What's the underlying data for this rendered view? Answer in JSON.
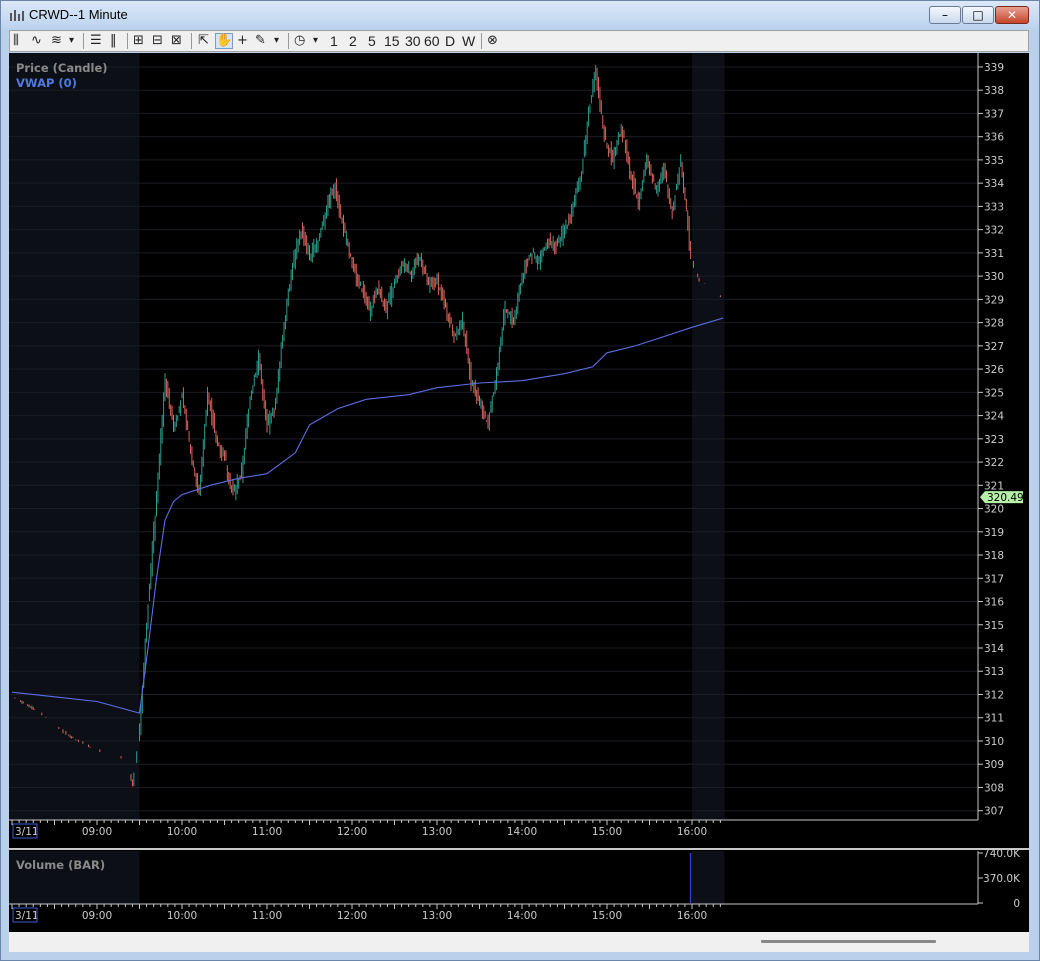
{
  "window": {
    "title": "CRWD--1 Minute",
    "controls": {
      "minimize": "–",
      "maximize": "□",
      "close": "✕"
    }
  },
  "toolbar": {
    "tools": [
      {
        "name": "bar-chart-icon",
        "glyph": "⫼"
      },
      {
        "name": "line-chart-icon",
        "glyph": "∿"
      },
      {
        "name": "indicator-icon",
        "glyph": "≋"
      },
      {
        "name": "chart-type-dropdown-icon",
        "glyph": "▾"
      },
      {
        "name": "horizontal-split-icon",
        "glyph": "☰"
      },
      {
        "name": "vertical-split-icon",
        "glyph": "‖"
      },
      {
        "name": "zoom-in-icon",
        "glyph": "⊞"
      },
      {
        "name": "zoom-out-icon",
        "glyph": "⊟"
      },
      {
        "name": "fit-icon",
        "glyph": "⊠"
      },
      {
        "name": "pointer-icon",
        "glyph": "⇱"
      },
      {
        "name": "pan-hand-icon",
        "glyph": "✋"
      },
      {
        "name": "crosshair-icon",
        "glyph": "+"
      },
      {
        "name": "pencil-icon",
        "glyph": "✎"
      },
      {
        "name": "draw-dropdown-icon",
        "glyph": "▾"
      },
      {
        "name": "clock-icon",
        "glyph": "◷"
      },
      {
        "name": "interval-dropdown-icon",
        "glyph": "▾"
      }
    ],
    "intervals": [
      "1",
      "2",
      "5",
      "15",
      "30",
      "60",
      "D",
      "W"
    ],
    "cancel_glyph": "⊗"
  },
  "price_panel": {
    "title": "Price (Candle)",
    "indicator": "VWAP (0)",
    "last_price": "320.49"
  },
  "volume_panel": {
    "title": "Volume (BAR)",
    "y_ticks": [
      "740.0K",
      "370.0K",
      "0"
    ]
  },
  "colors": {
    "up": "#2e9c8c",
    "down": "#d9655c",
    "vwap": "#5b6ee8",
    "session_shade": "#0c0f16",
    "axis_text": "#cccccc",
    "panel_title": "#8a8a8a",
    "indicator_title": "#4f7be0",
    "last_price_bg": "#b7f0a8"
  },
  "chart_data": [
    {
      "type": "candlestick",
      "title": "Price (Candle)",
      "series": [
        {
          "name": "VWAP (0)"
        }
      ],
      "x_date_label": "3/11",
      "x_tick_labels": [
        "09:00",
        "10:00",
        "11:00",
        "12:00",
        "13:00",
        "14:00",
        "15:00",
        "16:00"
      ],
      "y_ticks": [
        307,
        308,
        309,
        310,
        311,
        312,
        313,
        314,
        315,
        316,
        317,
        318,
        319,
        320,
        321,
        322,
        323,
        324,
        325,
        326,
        327,
        328,
        329,
        330,
        331,
        332,
        333,
        334,
        335,
        336,
        337,
        338,
        339
      ],
      "ylim": [
        306.6,
        339.6
      ],
      "xlim": [
        "08:00",
        "19:29"
      ],
      "close_path": [
        [
          "08:00",
          311.9
        ],
        [
          "08:20",
          311.2
        ],
        [
          "08:40",
          310.2
        ],
        [
          "09:00",
          309.6
        ],
        [
          "09:20",
          309.2
        ],
        [
          "09:25",
          308.1
        ],
        [
          "09:30",
          310.5
        ],
        [
          "09:36",
          316.0
        ],
        [
          "09:42",
          320.5
        ],
        [
          "09:48",
          325.6
        ],
        [
          "09:54",
          323.5
        ],
        [
          "10:00",
          324.8
        ],
        [
          "10:06",
          322.5
        ],
        [
          "10:12",
          320.6
        ],
        [
          "10:18",
          325.0
        ],
        [
          "10:24",
          323.0
        ],
        [
          "10:30",
          322.2
        ],
        [
          "10:36",
          320.6
        ],
        [
          "10:42",
          321.5
        ],
        [
          "10:48",
          324.8
        ],
        [
          "10:54",
          326.5
        ],
        [
          "11:00",
          323.5
        ],
        [
          "11:06",
          324.5
        ],
        [
          "11:12",
          328.0
        ],
        [
          "11:18",
          330.5
        ],
        [
          "11:24",
          332.0
        ],
        [
          "11:30",
          330.8
        ],
        [
          "11:36",
          331.5
        ],
        [
          "11:42",
          333.0
        ],
        [
          "11:48",
          333.9
        ],
        [
          "11:54",
          332.0
        ],
        [
          "12:00",
          330.5
        ],
        [
          "12:06",
          329.6
        ],
        [
          "12:12",
          328.5
        ],
        [
          "12:18",
          329.5
        ],
        [
          "12:24",
          328.6
        ],
        [
          "12:30",
          329.6
        ],
        [
          "12:36",
          330.5
        ],
        [
          "12:42",
          330.2
        ],
        [
          "12:48",
          330.8
        ],
        [
          "12:54",
          329.5
        ],
        [
          "13:00",
          329.8
        ],
        [
          "13:06",
          328.7
        ],
        [
          "13:12",
          327.5
        ],
        [
          "13:18",
          328.0
        ],
        [
          "13:24",
          325.5
        ],
        [
          "13:30",
          324.6
        ],
        [
          "13:36",
          323.6
        ],
        [
          "13:42",
          325.8
        ],
        [
          "13:48",
          328.6
        ],
        [
          "13:54",
          328.0
        ],
        [
          "14:00",
          330.0
        ],
        [
          "14:06",
          331.0
        ],
        [
          "14:12",
          330.6
        ],
        [
          "14:18",
          331.5
        ],
        [
          "14:24",
          331.2
        ],
        [
          "14:30",
          332.0
        ],
        [
          "14:36",
          333.0
        ],
        [
          "14:42",
          334.5
        ],
        [
          "14:48",
          337.5
        ],
        [
          "14:52",
          338.8
        ],
        [
          "14:58",
          336.0
        ],
        [
          "15:04",
          335.0
        ],
        [
          "15:10",
          336.5
        ],
        [
          "15:16",
          334.5
        ],
        [
          "15:22",
          333.2
        ],
        [
          "15:28",
          335.0
        ],
        [
          "15:34",
          333.8
        ],
        [
          "15:40",
          334.5
        ],
        [
          "15:46",
          332.8
        ],
        [
          "15:52",
          335.0
        ],
        [
          "15:58",
          331.5
        ],
        [
          "16:00",
          330.6
        ],
        [
          "16:06",
          329.6
        ],
        [
          "16:12",
          329.8
        ],
        [
          "16:18",
          329.3
        ],
        [
          "16:22",
          328.9
        ]
      ],
      "vwap": [
        [
          "08:00",
          312.1
        ],
        [
          "08:30",
          311.9
        ],
        [
          "09:00",
          311.7
        ],
        [
          "09:30",
          311.2
        ],
        [
          "09:36",
          314.0
        ],
        [
          "09:42",
          317.0
        ],
        [
          "09:48",
          319.5
        ],
        [
          "09:54",
          320.3
        ],
        [
          "10:00",
          320.6
        ],
        [
          "10:20",
          321.0
        ],
        [
          "10:40",
          321.3
        ],
        [
          "11:00",
          321.5
        ],
        [
          "11:20",
          322.4
        ],
        [
          "11:30",
          323.6
        ],
        [
          "11:50",
          324.3
        ],
        [
          "12:10",
          324.7
        ],
        [
          "12:40",
          324.9
        ],
        [
          "13:00",
          325.2
        ],
        [
          "13:30",
          325.4
        ],
        [
          "14:00",
          325.5
        ],
        [
          "14:30",
          325.8
        ],
        [
          "14:50",
          326.1
        ],
        [
          "15:00",
          326.7
        ],
        [
          "15:20",
          327.0
        ],
        [
          "15:40",
          327.4
        ],
        [
          "16:00",
          327.8
        ],
        [
          "16:22",
          328.2
        ]
      ]
    },
    {
      "type": "bar",
      "title": "Volume (BAR)",
      "x_date_label": "3/11",
      "x_tick_labels": [
        "09:00",
        "10:00",
        "11:00",
        "12:00",
        "13:00",
        "14:00",
        "15:00",
        "16:00"
      ],
      "y_ticks": [
        "740.0K",
        "370.0K",
        "0"
      ],
      "ylim": [
        0,
        740000
      ],
      "bars": [
        {
          "x": "15:59",
          "value": 740000
        }
      ]
    }
  ]
}
